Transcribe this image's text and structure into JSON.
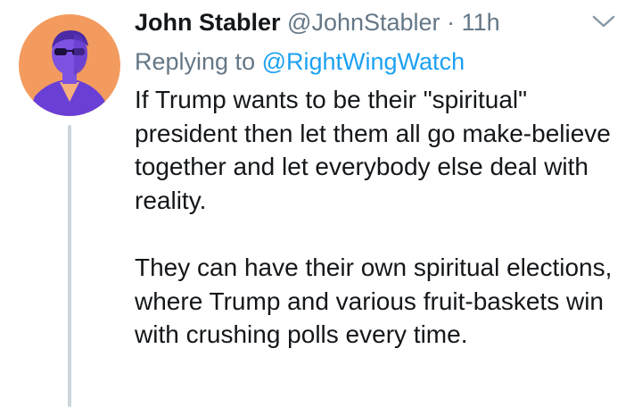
{
  "tweet": {
    "display_name": "John Stabler",
    "handle": "@JohnStabler",
    "separator": "·",
    "time": "11h",
    "replying_prefix": "Replying to",
    "replying_handle": "@RightWingWatch",
    "paragraphs": [
      "If Trump wants to be their \"spiritual\" president then let them all go make-believe together and let everybody else deal with reality.",
      "They can have their own spiritual elections, where Trump and various fruit-baskets win with crushing polls every time."
    ]
  },
  "icons": {
    "avatar": "avatar-image",
    "menu": "chevron-down-icon"
  },
  "colors": {
    "text": "#14171a",
    "muted": "#657786",
    "link": "#1da1f2",
    "thread_line": "#ccd6dd",
    "avatar_bg": "#f39b5e",
    "avatar_figure": "#6a3fd6"
  }
}
